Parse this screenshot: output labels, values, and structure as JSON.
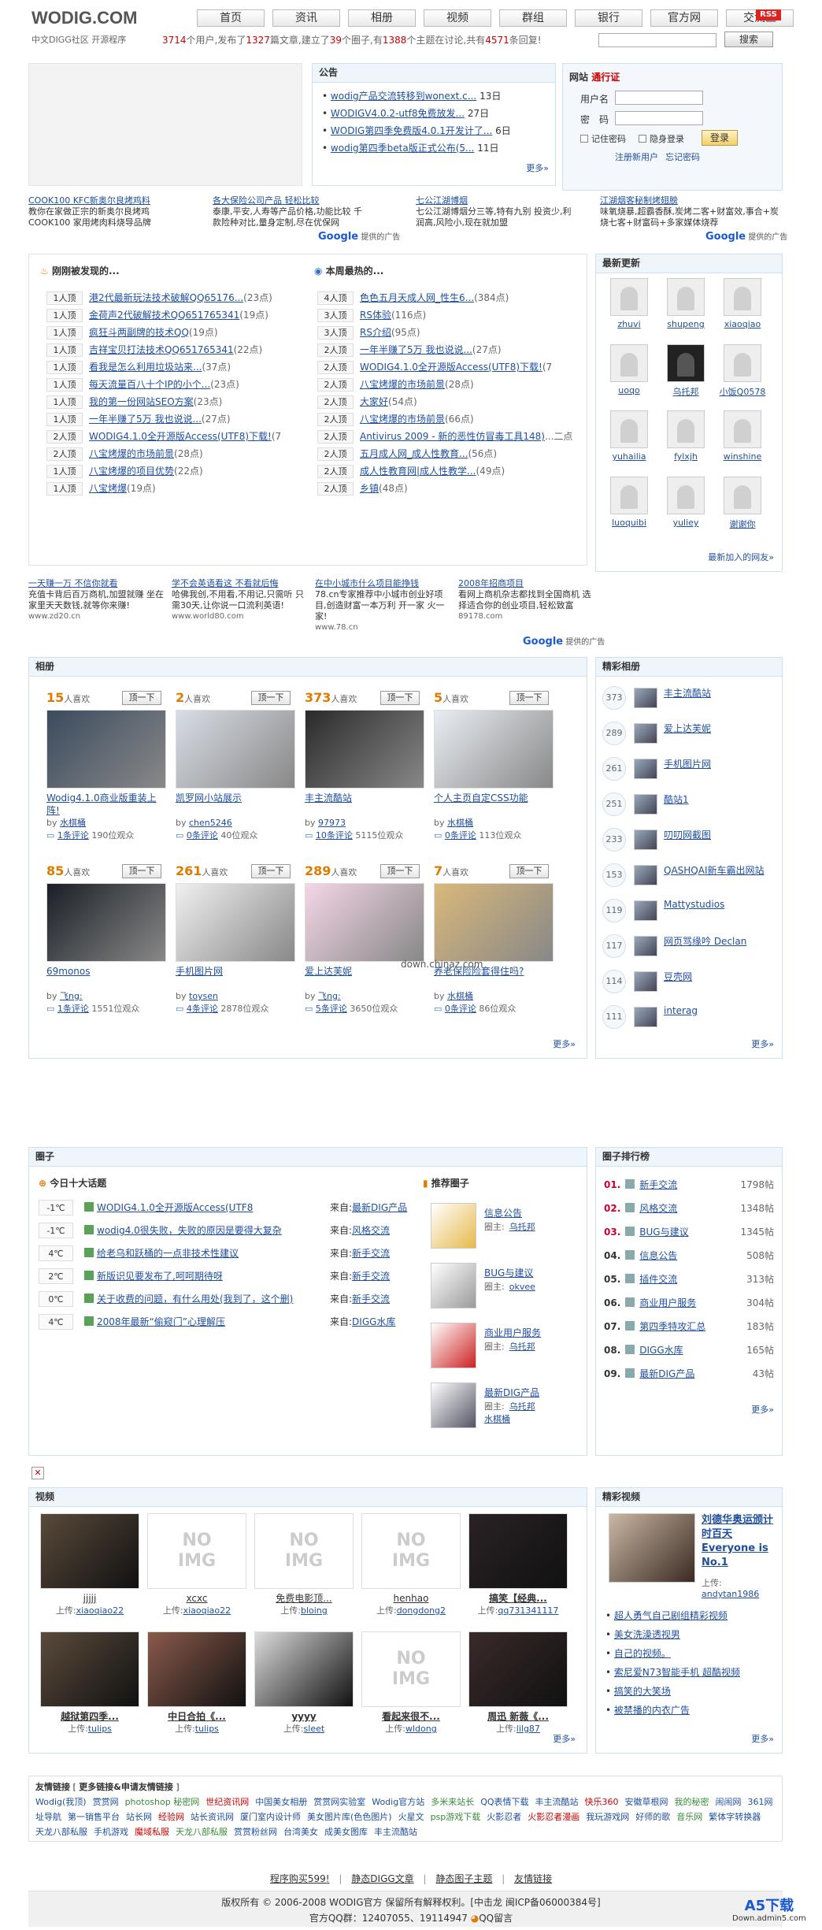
{
  "header": {
    "logo": "WODIG.COM",
    "slogan": "中文DIGG社区 开源程序",
    "nav": [
      "首页",
      "资讯",
      "相册",
      "视频",
      "群组",
      "银行",
      "官方网",
      "交流区"
    ],
    "rss": "RSS",
    "stats": {
      "users": "3714",
      "p1": "个用户,发布了",
      "articles": "1327",
      "p2": "篇文章,建立了",
      "groups": "39",
      "p3": "个圈子,有",
      "topics": "1388",
      "p4": "个主题在讨论,共有",
      "replies": "4571",
      "p5": "条回复!"
    },
    "search_button": "搜索"
  },
  "announce": {
    "title": "公告",
    "items": [
      {
        "t": "wodig产品交流转移到wonext.c...",
        "d": "13日"
      },
      {
        "t": "WODIGV4.0.2-utf8免费放发...",
        "d": "27日"
      },
      {
        "t": "WODIG第四季免费版4.0.1开发计了...",
        "d": "6日"
      },
      {
        "t": "wodig第四季beta版正式公布(5...",
        "d": "11日"
      }
    ],
    "more": "更多»"
  },
  "login": {
    "title": "网站",
    "title2": "通行证",
    "user_label": "用户名",
    "pass_label": "密　码",
    "remember": "记住密码",
    "hide": "隐身登录",
    "login_btn": "登录",
    "register": "注册新用户",
    "forgot": "忘记密码"
  },
  "ads1": [
    {
      "t": "COOK100 KFC新奥尔良烤鸡料",
      "s": "教你在家做正宗的新奥尔良烤鸡 COOK100 家用烤肉料烧导品牌"
    },
    {
      "t": "各大保险公司产品 轻松比较",
      "s": "泰康,平安,人寿等产品价格,功能比较 千款险种对比,量身定制,尽在优保网"
    },
    {
      "t": "七公江湖博烟",
      "s": "七公江湖博烟分三等,特有九别 投资少,利润高,风险小,现在就加盟"
    },
    {
      "t": "江湖烟客秘制烤翅膀",
      "s": "味氧烧暴,超霸香酥,炭烤二客+财富效,事合+炭烧七客+财富码+多家媒体烧荐"
    }
  ],
  "google_ads": "Google",
  "google_ads_suffix": "提供的广告",
  "discover": {
    "title": "刚刚被发现的...",
    "items": [
      {
        "n": "1人顶",
        "t": "港2代最新玩法技术破解QQ65176...",
        "c": "(23点)"
      },
      {
        "n": "1人顶",
        "t": "金荷声2代破解技术QQ651765341",
        "c": "(19点)"
      },
      {
        "n": "1人顶",
        "t": "疯狂斗两副牌的技术QQ",
        "c": "(19点)"
      },
      {
        "n": "1人顶",
        "t": "吉祥宝贝打法技术QQ651765341",
        "c": "(22点)"
      },
      {
        "n": "1人顶",
        "t": "看我是怎么利用垃圾站来...",
        "c": "(37点)"
      },
      {
        "n": "1人顶",
        "t": "每天流量百八十个IP的小个...",
        "c": "(23点)"
      },
      {
        "n": "1人顶",
        "t": "我的第一份网站SEO方案",
        "c": "(23点)"
      },
      {
        "n": "1人顶",
        "t": "一年半赚了5万 我也说说...",
        "c": "(27点)"
      },
      {
        "n": "2人顶",
        "t": "WODIG4.1.0全开源版Access(UTF8)下载!",
        "c": "(7"
      },
      {
        "n": "2人顶",
        "t": "八宝烤爆的市场前景",
        "c": "(28点)"
      },
      {
        "n": "1人顶",
        "t": "八宝烤爆的项目优势",
        "c": "(22点)"
      },
      {
        "n": "1人顶",
        "t": "八宝烤爆",
        "c": "(19点)"
      }
    ]
  },
  "hot": {
    "title": "本周最热的...",
    "items": [
      {
        "n": "4人顶",
        "t": "色色五月天成人网_性生6...",
        "c": "(384点)"
      },
      {
        "n": "3人顶",
        "t": "RS体验",
        "c": "(116点)"
      },
      {
        "n": "3人顶",
        "t": "RS介绍",
        "c": "(95点)"
      },
      {
        "n": "2人顶",
        "t": "一年半赚了5万 我也说说...",
        "c": "(27点)"
      },
      {
        "n": "2人顶",
        "t": "WODIG4.1.0全开源版Access(UTF8)下载!",
        "c": "(7"
      },
      {
        "n": "2人顶",
        "t": "八宝烤爆的市场前景",
        "c": "(28点)"
      },
      {
        "n": "2人顶",
        "t": "大家好",
        "c": "(54点)"
      },
      {
        "n": "2人顶",
        "t": "八宝烤爆的市场前景",
        "c": "(66点)"
      },
      {
        "n": "2人顶",
        "t": "Antivirus 2009 - 新的恶性仿冒毒工具148)",
        "c": "...二点"
      },
      {
        "n": "2人顶",
        "t": "五月成人网_成人性教育...",
        "c": "(56点)"
      },
      {
        "n": "2人顶",
        "t": "成人性教育网|成人性教学...",
        "c": "(49点)"
      },
      {
        "n": "2人顶",
        "t": "乡镇",
        "c": "(48点)"
      }
    ]
  },
  "latest": {
    "title": "最新更新",
    "users": [
      "zhuvi",
      "shupeng",
      "xiaoqiao",
      "uoqo",
      "乌托邦",
      "小饭Q0578",
      "yuhailia",
      "fylxjh",
      "winshine",
      "luoquibi",
      "yuliey",
      "谢谢你"
    ],
    "more": "最新加入的网友»"
  },
  "ads2": [
    {
      "t": "一天赚一万 不信你就看",
      "s": "充值卡背后百万商机,加盟就赚 坐在家里天天数钱,就等你来赚!",
      "u": "www.zd20.cn"
    },
    {
      "t": "学不会英语看这 不看就后悔",
      "s": "哈佛我创,不用看,不用记,只需听 只需30天,让你说一口流利英语!",
      "u": "www.world80.com"
    },
    {
      "t": "在中小城市什么项目能挣钱",
      "s": "78.cn专家推荐中小城市创业好项目,创造财富一本万利 开一家 火一家!",
      "u": "www.78.cn"
    },
    {
      "t": "2008年招商项目",
      "s": "看网上商机杂志都找到全国商机 选择适合你的创业项目,轻松致富",
      "u": "89178.com"
    }
  ],
  "album": {
    "title": "相册",
    "photos": [
      {
        "likes": "15",
        "lbl": "人喜欢",
        "up": "顶一下",
        "t": "Wodig4.1.0商业版重装上阵!",
        "by": "水棋桶",
        "cm": "1条评论",
        "v": "190位观众",
        "img": "#3b4b5e"
      },
      {
        "likes": "2",
        "lbl": "人喜欢",
        "up": "顶一下",
        "t": "凯罗网小站展示",
        "by": "chen5246",
        "cm": "0条评论",
        "v": "40位观众",
        "img": "#d8dde5"
      },
      {
        "likes": "373",
        "lbl": "人喜欢",
        "up": "顶一下",
        "t": "丰主流酷站",
        "by": "97973",
        "cm": "10条评论",
        "v": "5115位观众",
        "img": "#2a2a2a"
      },
      {
        "likes": "5",
        "lbl": "人喜欢",
        "up": "顶一下",
        "t": "个人主页自定CSS功能",
        "by": "水棋桶",
        "cm": "0条评论",
        "v": "113位观众",
        "img": "#e9edf3"
      },
      {
        "likes": "85",
        "lbl": "人喜欢",
        "up": "顶一下",
        "t": "69monos",
        "by": "飞ng:",
        "cm": "1条评论",
        "v": "1551位观众",
        "img": "#1a1f26"
      },
      {
        "likes": "261",
        "lbl": "人喜欢",
        "up": "顶一下",
        "t": "手机图片网",
        "by": "toysen",
        "cm": "4条评论",
        "v": "2878位观众",
        "img": "#f0f0f0"
      },
      {
        "likes": "289",
        "lbl": "人喜欢",
        "up": "顶一下",
        "t": "爱上达芙妮",
        "by": "飞ng:",
        "cm": "5条评论",
        "v": "3650位观众",
        "img": "#f4d6e6"
      },
      {
        "likes": "7",
        "lbl": "人喜欢",
        "up": "顶一下",
        "t": "养老保险险套得住吗?",
        "by": "水棋桶",
        "cm": "0条评论",
        "v": "86位观众",
        "img": "#d9b87a"
      }
    ],
    "watermark": "down.chinaz.com",
    "more": "更多»"
  },
  "featured_albums": {
    "title": "精彩相册",
    "items": [
      {
        "n": "373",
        "t": "丰主流酷站"
      },
      {
        "n": "289",
        "t": "爱上达芙妮"
      },
      {
        "n": "261",
        "t": "手机图片网"
      },
      {
        "n": "251",
        "t": "酷站1"
      },
      {
        "n": "233",
        "t": "叨叨网截图"
      },
      {
        "n": "153",
        "t": "QASHQAI新车霸出网站"
      },
      {
        "n": "119",
        "t": "Mattystudios"
      },
      {
        "n": "117",
        "t": "网页骂缘吟 Declan"
      },
      {
        "n": "114",
        "t": "豆壳网"
      },
      {
        "n": "111",
        "t": "interag"
      }
    ],
    "more": "更多»"
  },
  "circle": {
    "title": "圈子",
    "topten_title": "今日十大话题",
    "topics": [
      {
        "temp": "-1℃",
        "t": "WODIG4.1.0全开源版Access(UTF8",
        "from": "最新DIG产品"
      },
      {
        "temp": "-1℃",
        "t": "wodig4.0很失败，失败的原因是要得大复杂",
        "from": "风格交流"
      },
      {
        "temp": "4℃",
        "t": "给老乌和跃桶的一点非技术性建议",
        "from": "新手交流"
      },
      {
        "temp": "2℃",
        "t": "新版识见要发布了,呵呵期待呀",
        "from": "新手交流"
      },
      {
        "temp": "0℃",
        "t": "关于收费的问题，有什么用处(我到了，这个删)",
        "from": "新手交流"
      },
      {
        "temp": "4℃",
        "t": "2008年最新“偷窥门”心理解压",
        "from": "DIGG水库"
      }
    ],
    "from_lbl": "来自:",
    "rec_title": "推荐圈子",
    "rec": [
      {
        "t": "信息公告",
        "owner": "乌托邦"
      },
      {
        "t": "BUG与建议",
        "owner": "okvee"
      },
      {
        "t": "商业用户服务",
        "owner": "乌托邦"
      },
      {
        "t": "最新DIG产品",
        "owner": "乌托邦",
        "owner2": "水棋桶"
      }
    ],
    "owner_lbl": "圈主:"
  },
  "circle_rank": {
    "title": "圈子排行榜",
    "items": [
      {
        "n": "01.",
        "t": "新手交流",
        "c": "1798帖"
      },
      {
        "n": "02.",
        "t": "风格交流",
        "c": "1348帖"
      },
      {
        "n": "03.",
        "t": "BUG与建议",
        "c": "1345帖"
      },
      {
        "n": "04.",
        "t": "信息公告",
        "c": "508帖"
      },
      {
        "n": "05.",
        "t": "插件交流",
        "c": "313帖"
      },
      {
        "n": "06.",
        "t": "商业用户服务",
        "c": "304帖"
      },
      {
        "n": "07.",
        "t": "第四季特攻汇总",
        "c": "183帖"
      },
      {
        "n": "08.",
        "t": "DIGG水库",
        "c": "165帖"
      },
      {
        "n": "09.",
        "t": "最新DIG产品",
        "c": "43帖"
      }
    ],
    "more": "更多»"
  },
  "video": {
    "title": "视频",
    "items": [
      {
        "t": "jjjjj",
        "u": "xiaoqiao22",
        "c": "#5a4a3a"
      },
      {
        "t": "xcxc",
        "u": "xiaoqiao22",
        "c": "none"
      },
      {
        "t": "免费电影顶...",
        "u": "bloing",
        "c": "none"
      },
      {
        "t": "henhao",
        "u": "dongdong2",
        "c": "none"
      },
      {
        "t": "搞笑【经典...",
        "u": "qq731341117",
        "c": "#2a2225"
      },
      {
        "t": "越狱第四季...",
        "u": "tulips",
        "c": "#5b4b3b"
      },
      {
        "t": "中日合拍《...",
        "u": "tulips",
        "c": "#8a5a4a"
      },
      {
        "t": "yyyy",
        "u": "sleet",
        "c": "#dcdcdc"
      },
      {
        "t": "看起来很不...",
        "u": "wldong",
        "c": "none"
      },
      {
        "t": "周迅 新薇《...",
        "u": "lilg87",
        "c": "#3a2a2a"
      }
    ],
    "upload_lbl": "上传:",
    "noimg": "NO IMG",
    "more": "更多»"
  },
  "featured_video": {
    "title": "精彩视频",
    "headline": "刘德华奥运颁计时百天 Everyone is No.1",
    "uploader_lbl": "上传:",
    "uploader": "andytan1986",
    "links": [
      "超人勇气自己剧组精彩视频",
      "美女洗澡透视男",
      "自己的视频。",
      "索尼爱N73智能手机 超酷视频",
      "搞笑的大笑场",
      "被禁播的内衣广告"
    ],
    "more": "更多»"
  },
  "friend_links": {
    "title": "友情链接",
    "title2": "更多链接&申请友情链接",
    "links": [
      "Wodig(我顶)",
      "赏赏网",
      "photoshop 秘密网",
      "世纪资讯网",
      "中国美女相册",
      "赏赏网实验室",
      "Wodig官方站",
      "多米来站长",
      "QQ表情下载",
      "丰主流酷站",
      "快乐360",
      "安徽草根网",
      "我的秘密",
      "闹闹网",
      "361网址导航",
      "第一销售平台",
      "站长网",
      "经验网",
      "站长资讯网",
      "厦门室内设计师",
      "美女图片库(色色图片)",
      "火星文",
      "psp游戏下载",
      "火影忍者",
      "火影忍者漫画",
      "我玩游戏网",
      "好师的歌",
      "音乐网",
      "繁体字转换器",
      "天龙八部私服",
      "手机游戏",
      "魔域私服",
      "天龙八部私服",
      "赏赏粉丝网",
      "台湾美女",
      "成美女图库",
      "丰主流酷站"
    ]
  },
  "footer": {
    "links": [
      "程序购买599!",
      "静态DIGG文章",
      "静态图子主题",
      "友情链接"
    ],
    "copy": "版权所有 © 2006-2008 WODIG官方 保留所有解释权利。[中击龙 闽ICP备06000384号]",
    "qq": "官方QQ群：12407055、19114947",
    "leave_msg": "QQ留言",
    "watermark": "A5下载",
    "watermark2": "Down.admin5.com"
  },
  "colors": {
    "accent": "#c00",
    "link": "#1f4e9c",
    "box_border": "#cfe0ee",
    "box_head": "#eef5fb"
  }
}
